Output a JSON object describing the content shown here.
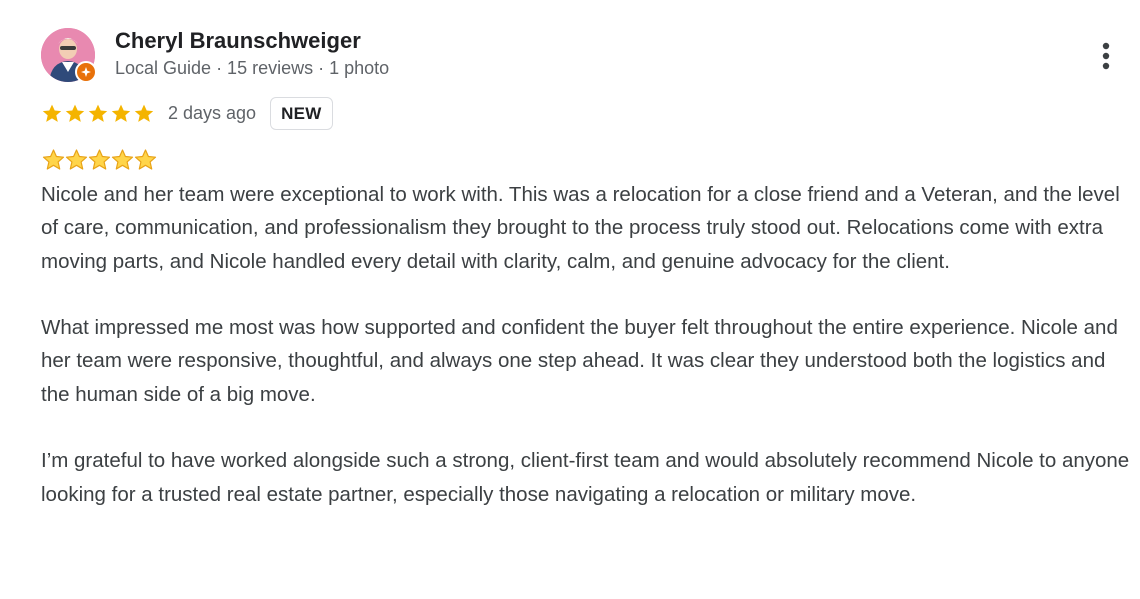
{
  "reviewer": {
    "name": "Cheryl Braunschweiger",
    "meta": "Local Guide · 15 reviews · 1 photo",
    "badge_icon": "local-guide-star-icon",
    "avatar_bg": "#e58bb0",
    "badge_color": "#e8710a"
  },
  "rating": {
    "stars": 5,
    "max_stars": 5,
    "star_color": "#f4b400",
    "date": "2 days ago",
    "new_label": "NEW"
  },
  "review": {
    "emoji_stars": 5,
    "paragraphs": [
      "Nicole and her team were exceptional to work with. This was a relocation for a close friend and a Veteran, and the level of care, communication, and professionalism they brought to the process truly stood out. Relocations come with extra moving parts, and Nicole handled every detail with clarity, calm, and genuine advocacy for the client.",
      "What impressed me most was how supported and confident the buyer felt throughout the entire experience. Nicole and her team were responsive, thoughtful, and always one step ahead. It was clear they understood both the logistics and the human side of a big move.",
      "I’m grateful to have worked alongside such a strong, client-first team and would absolutely recommend Nicole to anyone looking for a trusted real estate partner, especially those navigating a relocation or military move."
    ]
  },
  "menu": {
    "icon": "more-vert-icon"
  }
}
